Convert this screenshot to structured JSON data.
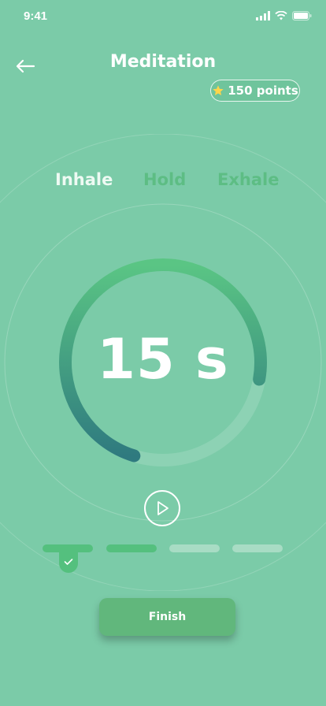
{
  "status_bar": {
    "time": "9:41"
  },
  "header": {
    "title": "Meditation",
    "points_label": "150 points"
  },
  "phases": [
    "Inhale",
    "Hold",
    "Exhale"
  ],
  "timer": {
    "value": "15 s",
    "progress": 0.73
  },
  "steps": {
    "completed": 2,
    "total": 4
  },
  "actions": {
    "finish_label": "Finish"
  },
  "colors": {
    "background": "#7bcba8",
    "accent": "#54c07e",
    "ring_start": "#5ac584",
    "ring_end": "#2f7a7f",
    "text_light": "#ffffff"
  },
  "icons": [
    "back-arrow-icon",
    "star-icon",
    "play-icon",
    "check-icon",
    "signal-icon",
    "wifi-icon",
    "battery-icon"
  ]
}
